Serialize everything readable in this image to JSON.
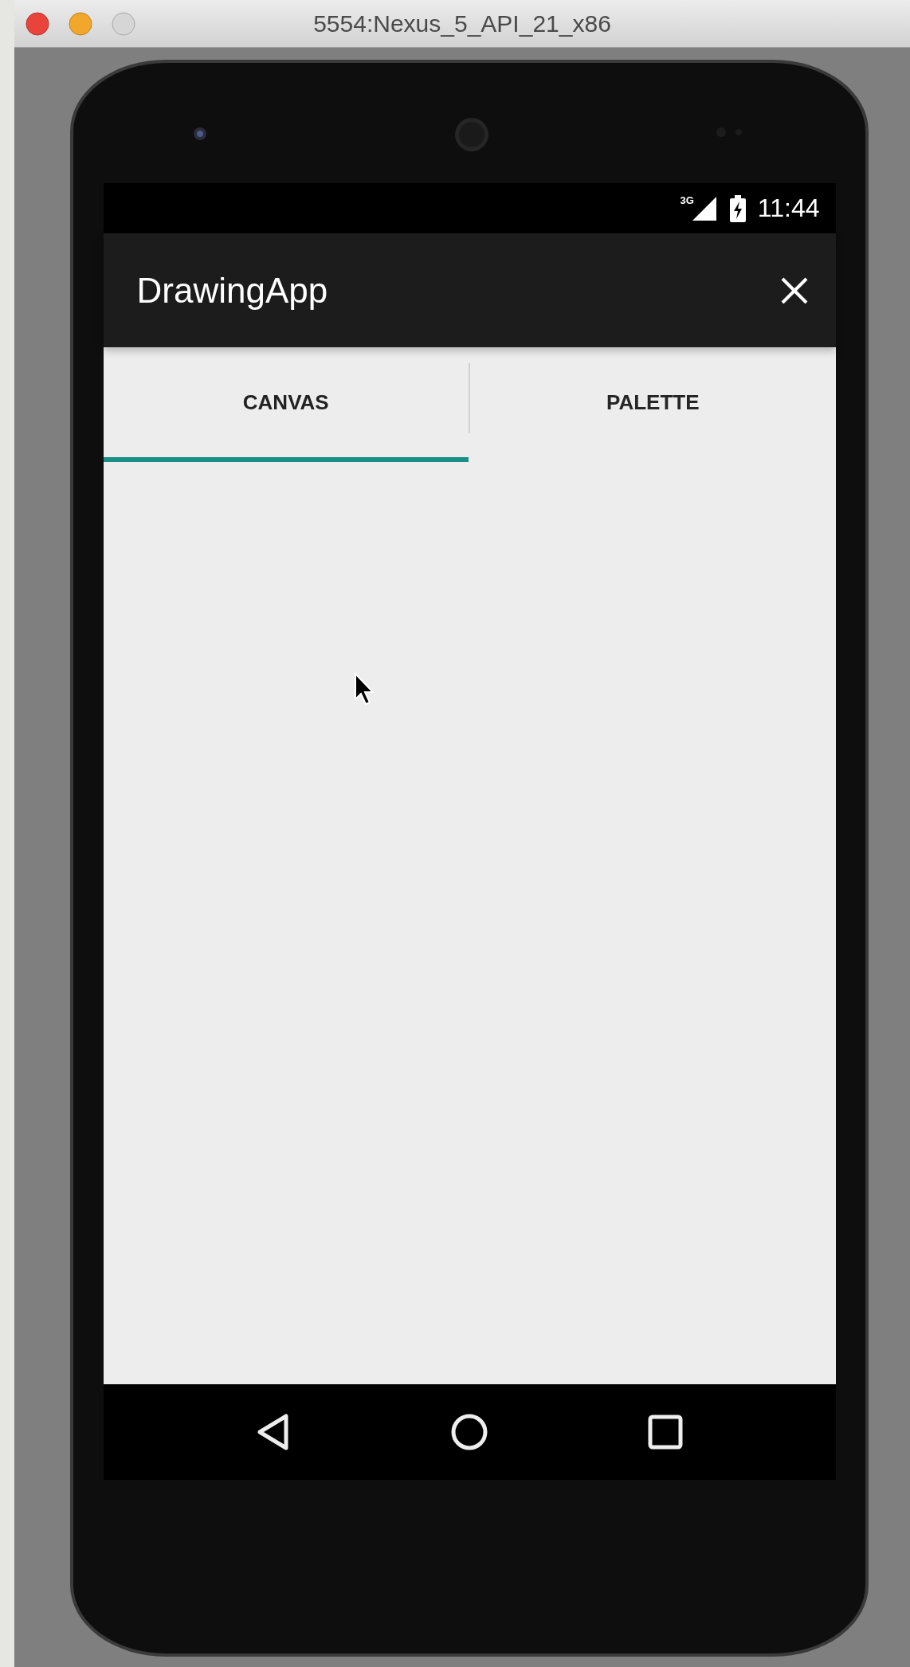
{
  "window": {
    "title": "5554:Nexus_5_API_21_x86"
  },
  "status_bar": {
    "network": "3G",
    "time": "11:44"
  },
  "app_bar": {
    "title": "DrawingApp"
  },
  "tabs": [
    {
      "label": "CANVAS",
      "selected": true
    },
    {
      "label": "PALETTE",
      "selected": false
    }
  ]
}
